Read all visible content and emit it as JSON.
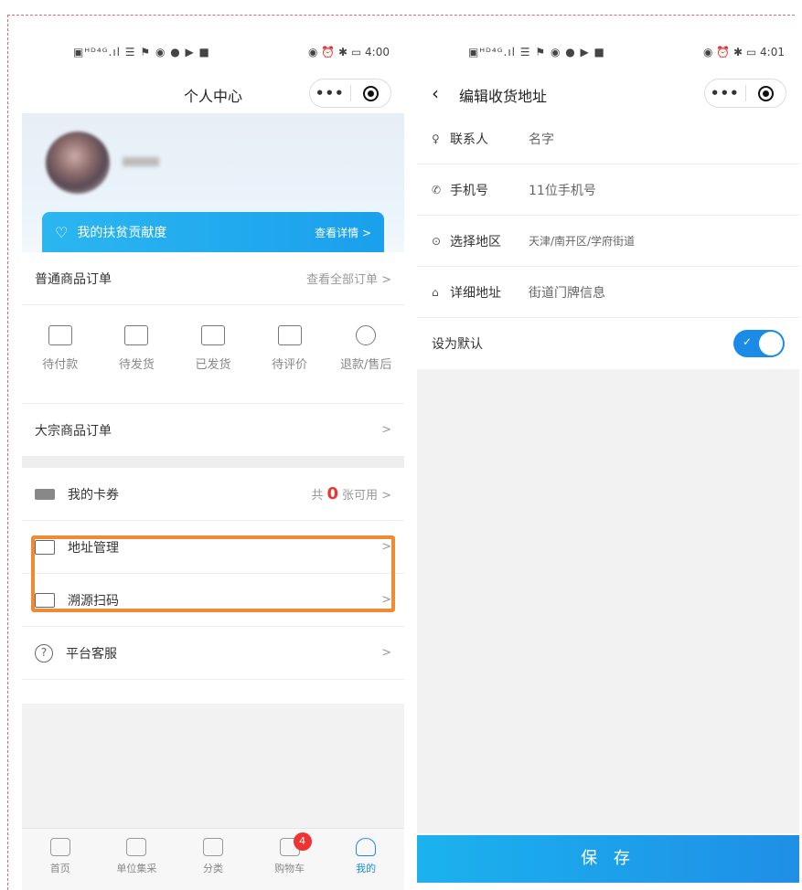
{
  "left": {
    "status": {
      "left_icons": "▣ᴴᴰ⁴ᴳ.ıl ☰ ⚑ ◉ ● ▶ ■",
      "right": "◉ ⏰ ✱ ▭ 4:00"
    },
    "title": "个人中心",
    "profile": {
      "contrib_label": "我的扶贫贡献度",
      "contrib_detail": "查看详情 >"
    },
    "orders": {
      "title": "普通商品订单",
      "view_all": "查看全部订单 >"
    },
    "order_status": [
      {
        "label": "待付款"
      },
      {
        "label": "待发货"
      },
      {
        "label": "已发货"
      },
      {
        "label": "待评价"
      },
      {
        "label": "退款/售后"
      }
    ],
    "bulk_orders": "大宗商品订单",
    "menu": {
      "coupons": {
        "label": "我的卡券",
        "prefix": "共",
        "count": "0",
        "suffix": "张可用 >"
      },
      "address": {
        "label": "地址管理"
      },
      "trace": {
        "label": "溯源扫码"
      },
      "service": {
        "label": "平台客服"
      }
    },
    "tabs": [
      {
        "label": "首页"
      },
      {
        "label": "单位集采"
      },
      {
        "label": "分类"
      },
      {
        "label": "购物车",
        "badge": "4"
      },
      {
        "label": "我的"
      }
    ]
  },
  "right": {
    "status": {
      "left_icons": "▣ᴴᴰ⁴ᴳ.ıl ☰ ⚑ ◉ ● ▶ ■",
      "right": "◉ ⏰ ✱ ▭ 4:01"
    },
    "title": "编辑收货地址",
    "fields": {
      "contact": {
        "label": "联系人",
        "value": "名字"
      },
      "phone": {
        "label": "手机号",
        "value": "11位手机号"
      },
      "region": {
        "label": "选择地区",
        "value": "天津/南开区/学府街道"
      },
      "detail": {
        "label": "详细地址",
        "value": "街道门牌信息"
      }
    },
    "default_label": "设为默认",
    "save_label": "保 存"
  },
  "colors": {
    "accent": "#1a8ce8",
    "highlight": "#ef8a35",
    "badge": "#e33333"
  }
}
